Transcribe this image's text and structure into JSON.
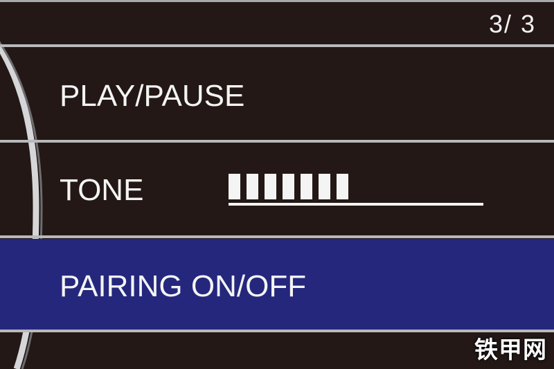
{
  "page_indicator": "3/ 3",
  "menu": {
    "items": [
      {
        "label": "PLAY/PAUSE",
        "selected": false
      },
      {
        "label": "TONE",
        "selected": false,
        "level": 0.45,
        "level_segments": 7
      },
      {
        "label": "PAIRING ON/OFF",
        "selected": true
      }
    ]
  },
  "colors": {
    "background": "#231815",
    "selected_row": "#25277d",
    "text": "#f4f4f4",
    "divider": "#b9b9bb"
  },
  "watermark": "铁甲网"
}
